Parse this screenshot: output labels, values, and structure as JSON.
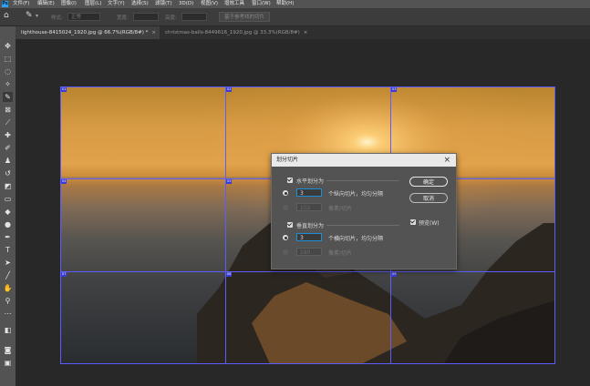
{
  "menubar": {
    "items": [
      "文件(F)",
      "编辑(E)",
      "图像(I)",
      "图层(L)",
      "文字(Y)",
      "选择(S)",
      "滤镜(T)",
      "3D(D)",
      "视图(V)",
      "增效工具",
      "窗口(W)",
      "帮助(H)"
    ]
  },
  "options": {
    "style_label": "样式:",
    "style_value": "正常",
    "width_label": "宽度:",
    "height_label": "高度:",
    "guides_button": "基于参考线的切片"
  },
  "tabs": [
    {
      "label": "lighthouse-8415024_1920.jpg @ 66.7%(RGB/8#) *",
      "close": "×"
    },
    {
      "label": "christmas-balls-8449616_1920.jpg @ 33.3%(RGB/8#)",
      "close": "×"
    }
  ],
  "slice_tags": [
    "01",
    "02",
    "03",
    "04",
    "05",
    "06",
    "07",
    "08",
    "09"
  ],
  "dialog": {
    "title": "划分切片",
    "close": "×",
    "horizontal": {
      "checkbox_label": "水平划分为",
      "count_value": "3",
      "count_suffix": "个纵向切片，均匀分隔",
      "pixel_value": "102",
      "pixel_suffix": "像素/切片"
    },
    "vertical": {
      "checkbox_label": "垂直划分为",
      "count_value": "3",
      "count_suffix": "个横向切片，均匀分隔",
      "pixel_value": "180",
      "pixel_suffix": "像素/切片"
    },
    "ok": "确定",
    "cancel": "取消",
    "preview": "预览(W)"
  },
  "colors": {
    "accent": "#1f8cd9",
    "guide": "#5d5dff",
    "panel": "#535353"
  }
}
